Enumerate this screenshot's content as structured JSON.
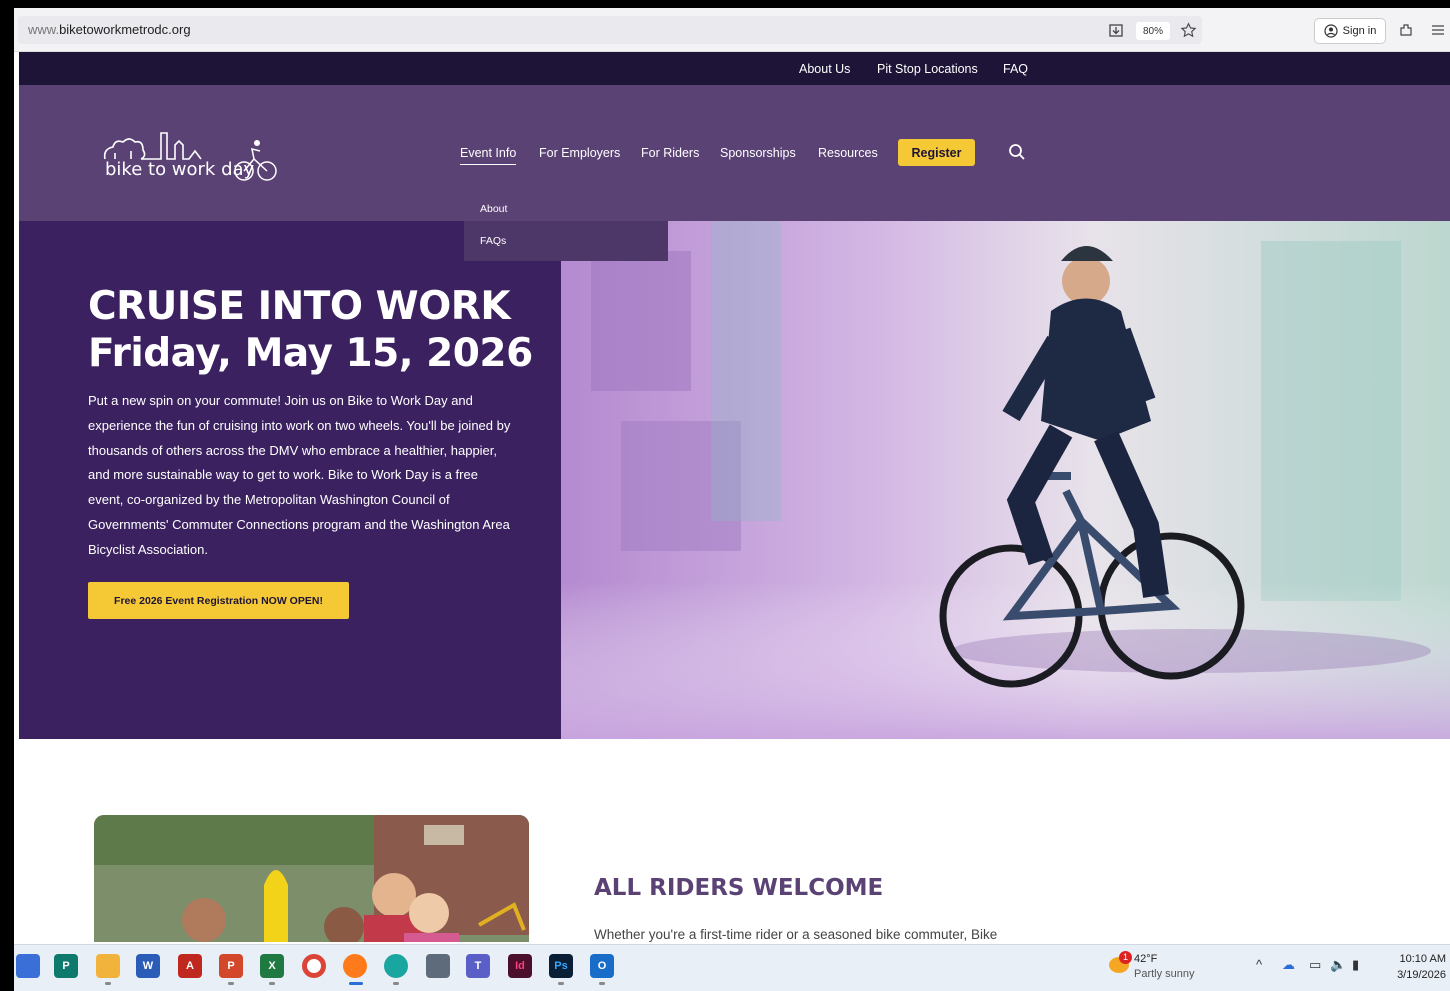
{
  "browser": {
    "url_prefix": "www.",
    "url_domain": "biketoworkmetrodc.org",
    "zoom": "80%",
    "sign_in_label": "Sign in"
  },
  "utility_nav": {
    "items": [
      "About Us",
      "Pit Stop Locations",
      "FAQ"
    ]
  },
  "main_nav": {
    "logo_text": "bike to work day",
    "items": [
      "Event Info",
      "For Employers",
      "For Riders",
      "Sponsorships",
      "Resources"
    ],
    "register_label": "Register",
    "dropdown": [
      "About",
      "FAQs"
    ]
  },
  "hero": {
    "title_line1": "CRUISE INTO WORK",
    "title_line2": "Friday, May 15, 2026",
    "body": "Put a new spin on your commute! Join us on Bike to Work Day and experience the fun of cruising into work on two wheels. You'll be joined by thousands of others across the DMV who embrace a healthier, happier, and more sustainable way to get to work. Bike to Work Day is a free event, co-organized by the Metropolitan Washington Council of Governments' Commuter Connections program and the Washington Area Bicyclist Association.",
    "cta_label": "Free 2026 Event Registration NOW OPEN!"
  },
  "riders": {
    "title": "ALL RIDERS WELCOME",
    "text": "Whether you're a first-time rider or a seasoned bike commuter, Bike"
  },
  "taskbar": {
    "weather_temp": "42°F",
    "weather_desc": "Partly sunny",
    "weather_badge": "1",
    "time": "10:10 AM",
    "date": "3/19/2026"
  },
  "colors": {
    "utility_bg": "#1e1437",
    "header_bg": "#5b4274",
    "hero_bg": "#3b2160",
    "accent_yellow": "#f5c935"
  }
}
